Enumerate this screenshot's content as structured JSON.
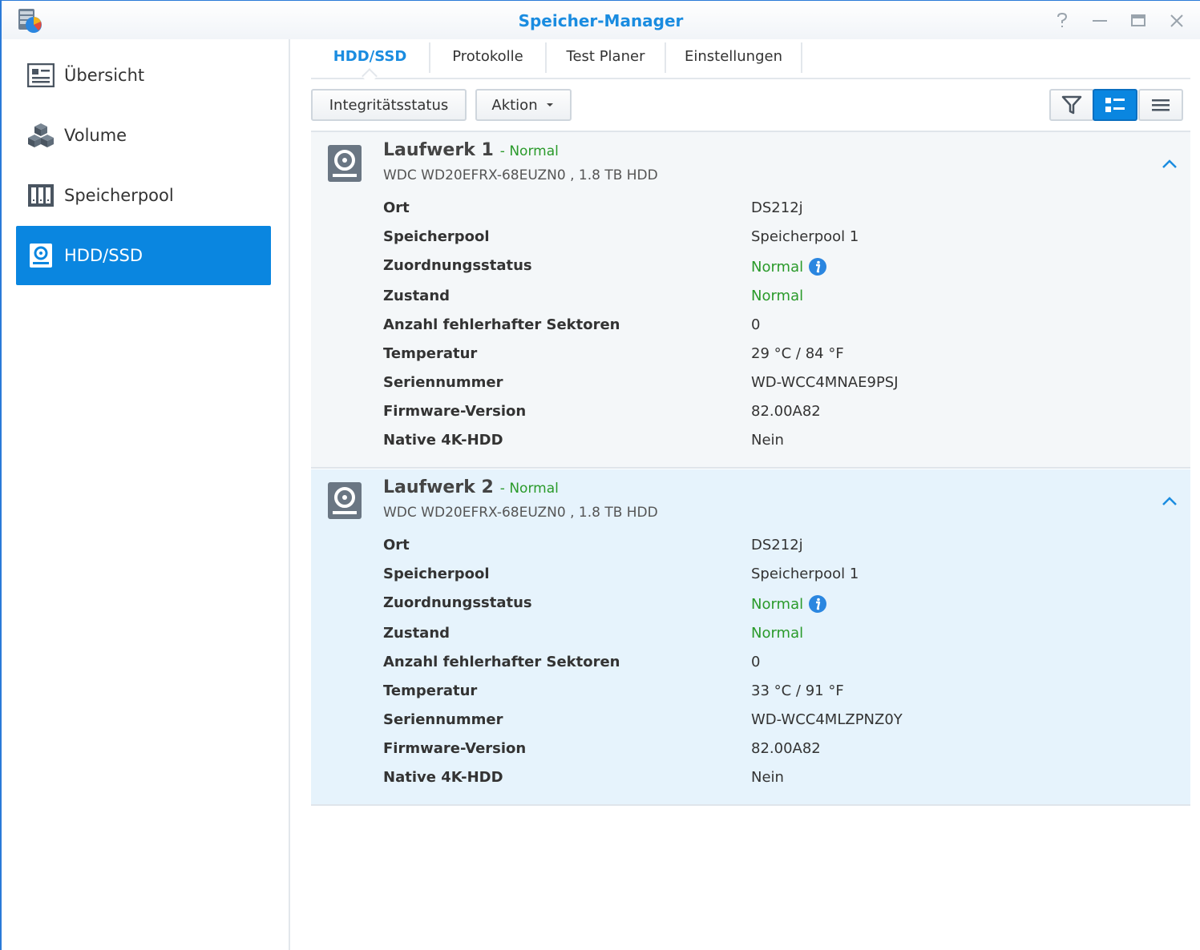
{
  "window": {
    "title": "Speicher-Manager"
  },
  "sidebar": {
    "items": [
      {
        "label": "Übersicht",
        "icon": "overview-icon",
        "active": false
      },
      {
        "label": "Volume",
        "icon": "volume-cubes-icon",
        "active": false
      },
      {
        "label": "Speicherpool",
        "icon": "storage-pool-icon",
        "active": false
      },
      {
        "label": "HDD/SSD",
        "icon": "hdd-icon",
        "active": true
      }
    ]
  },
  "tabs": [
    {
      "label": "HDD/SSD",
      "active": true
    },
    {
      "label": "Protokolle",
      "active": false
    },
    {
      "label": "Test Planer",
      "active": false
    },
    {
      "label": "Einstellungen",
      "active": false
    }
  ],
  "toolbar": {
    "health_label": "Integritätsstatus",
    "action_label": "Aktion",
    "filter_icon": "filter-icon",
    "detail_view_icon": "detail-list-icon",
    "list_view_icon": "list-icon"
  },
  "drives": [
    {
      "name": "Laufwerk 1",
      "status": "- Normal",
      "model": "WDC WD20EFRX-68EUZN0 , 1.8 TB HDD",
      "rows": [
        {
          "label": "Ort",
          "value": "DS212j"
        },
        {
          "label": "Speicherpool",
          "value": "Speicherpool 1"
        },
        {
          "label": "Zuordnungsstatus",
          "value": "Normal"
        },
        {
          "label": "Zustand",
          "value": "Normal"
        },
        {
          "label": "Anzahl fehlerhafter Sektoren",
          "value": "0"
        },
        {
          "label": "Temperatur",
          "value": "29 °C / 84 °F"
        },
        {
          "label": "Seriennummer",
          "value": "WD-WCC4MNAE9PSJ"
        },
        {
          "label": "Firmware-Version",
          "value": "82.00A82"
        },
        {
          "label": "Native 4K-HDD",
          "value": "Nein"
        }
      ]
    },
    {
      "name": "Laufwerk 2",
      "status": "- Normal",
      "model": "WDC WD20EFRX-68EUZN0 , 1.8 TB HDD",
      "rows": [
        {
          "label": "Ort",
          "value": "DS212j"
        },
        {
          "label": "Speicherpool",
          "value": "Speicherpool 1"
        },
        {
          "label": "Zuordnungsstatus",
          "value": "Normal"
        },
        {
          "label": "Zustand",
          "value": "Normal"
        },
        {
          "label": "Anzahl fehlerhafter Sektoren",
          "value": "0"
        },
        {
          "label": "Temperatur",
          "value": "33 °C / 91 °F"
        },
        {
          "label": "Seriennummer",
          "value": "WD-WCC4MLZPNZ0Y"
        },
        {
          "label": "Firmware-Version",
          "value": "82.00A82"
        },
        {
          "label": "Native 4K-HDD",
          "value": "Nein"
        }
      ]
    }
  ],
  "colors": {
    "accent": "#0a86e0",
    "title": "#1a8ce0",
    "ok": "#2a9a2a"
  }
}
